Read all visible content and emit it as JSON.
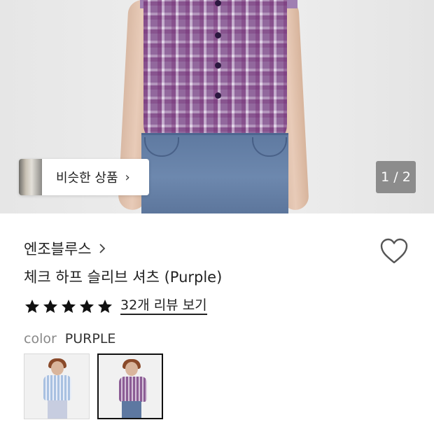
{
  "similar_products": {
    "label": "비슷한 상품",
    "chevron": "›"
  },
  "gallery": {
    "counter": "1 / 2"
  },
  "product": {
    "brand": "엔조블루스",
    "title": "체크 하프 슬리브 셔츠 (Purple)",
    "rating_stars": 5,
    "review_link": "32개 리뷰 보기",
    "color_label": "color",
    "color_value": "PURPLE"
  },
  "icons": {
    "brand_chevron": "chevron-right-icon",
    "wishlist": "heart-outline-icon",
    "star": "star-filled-icon"
  },
  "colors": {
    "text": "#222222",
    "muted": "#888888",
    "selected_border": "#111111"
  }
}
